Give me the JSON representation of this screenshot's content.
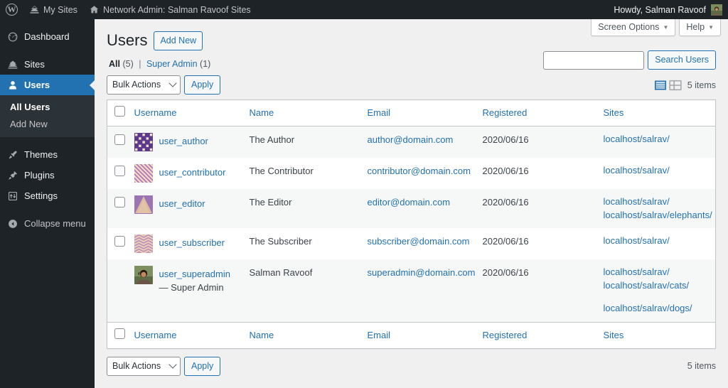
{
  "adminbar": {
    "wp_logo": "wordpress-logo-icon",
    "my_sites": "My Sites",
    "network_label": "Network Admin: Salman Ravoof Sites",
    "howdy": "Howdy, Salman Ravoof"
  },
  "sidebar": {
    "items": [
      {
        "label": "Dashboard",
        "icon": "dashboard-icon",
        "active": false
      },
      {
        "label": "Sites",
        "icon": "sites-icon",
        "active": false
      },
      {
        "label": "Users",
        "icon": "users-icon",
        "active": true
      },
      {
        "label": "Themes",
        "icon": "themes-icon",
        "active": false
      },
      {
        "label": "Plugins",
        "icon": "plugins-icon",
        "active": false
      },
      {
        "label": "Settings",
        "icon": "settings-icon",
        "active": false
      },
      {
        "label": "Collapse menu",
        "icon": "collapse-icon",
        "active": false
      }
    ],
    "submenu": [
      {
        "label": "All Users",
        "current": true
      },
      {
        "label": "Add New",
        "current": false
      }
    ]
  },
  "screen_meta": {
    "screen_options": "Screen Options",
    "help": "Help"
  },
  "header": {
    "title": "Users",
    "add_new": "Add New"
  },
  "filters": {
    "all_label": "All",
    "all_count": "(5)",
    "divider": "|",
    "superadmin_label": "Super Admin",
    "superadmin_count": "(1)"
  },
  "search": {
    "value": "",
    "placeholder": "",
    "button": "Search Users"
  },
  "toolbar": {
    "bulk_actions": "Bulk Actions",
    "apply": "Apply",
    "items_count": "5 items",
    "view_list": "list-view-icon",
    "view_excerpt": "excerpt-view-icon"
  },
  "table": {
    "columns": [
      "Username",
      "Name",
      "Email",
      "Registered",
      "Sites"
    ],
    "rows": [
      {
        "username": "user_author",
        "role_suffix": "",
        "name": "The Author",
        "email": "author@domain.com",
        "registered": "2020/06/16",
        "sites": [
          "localhost/salrav/"
        ],
        "sites_gap_after": -1,
        "has_checkbox": true,
        "avatar": "identicon-grid"
      },
      {
        "username": "user_contributor",
        "role_suffix": "",
        "name": "The Contributor",
        "email": "contributor@domain.com",
        "registered": "2020/06/16",
        "sites": [
          "localhost/salrav/"
        ],
        "sites_gap_after": -1,
        "has_checkbox": true,
        "avatar": "identicon-stripes"
      },
      {
        "username": "user_editor",
        "role_suffix": "",
        "name": "The Editor",
        "email": "editor@domain.com",
        "registered": "2020/06/16",
        "sites": [
          "localhost/salrav/",
          "localhost/salrav/elephants/"
        ],
        "sites_gap_after": -1,
        "has_checkbox": true,
        "avatar": "identicon-cone"
      },
      {
        "username": "user_subscriber",
        "role_suffix": "",
        "name": "The Subscriber",
        "email": "subscriber@domain.com",
        "registered": "2020/06/16",
        "sites": [
          "localhost/salrav/"
        ],
        "sites_gap_after": -1,
        "has_checkbox": true,
        "avatar": "identicon-zigzag"
      },
      {
        "username": "user_superadmin",
        "role_suffix": "— Super Admin",
        "name": "Salman Ravoof",
        "email": "superadmin@domain.com",
        "registered": "2020/06/16",
        "sites": [
          "localhost/salrav/",
          "localhost/salrav/cats/",
          "localhost/salrav/dogs/"
        ],
        "sites_gap_after": 1,
        "has_checkbox": false,
        "avatar": "photo-avatar"
      }
    ]
  },
  "colors": {
    "accent": "#2271b1",
    "adminbar_bg": "#1d2327",
    "sidebar_bg": "#1d2327",
    "submenu_bg": "#2c3338",
    "page_bg": "#f0f0f1",
    "row_alt": "#f6f7f7"
  }
}
